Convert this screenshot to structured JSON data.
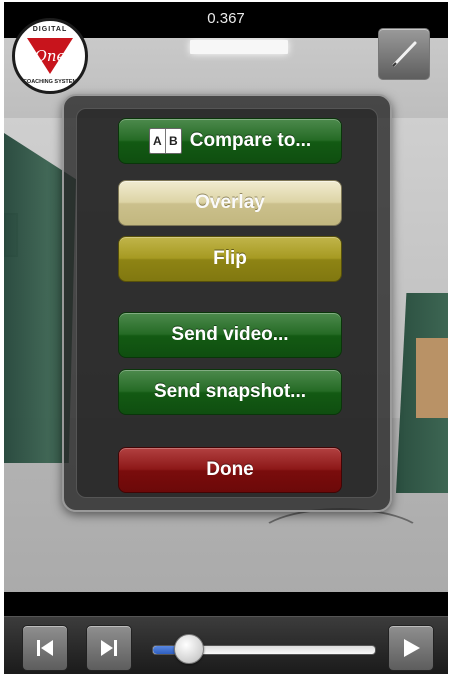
{
  "time_readout": "0.367",
  "logo": {
    "top_text": "DIGITAL",
    "bottom_text": "COACHING SYSTEM",
    "center_text": "One"
  },
  "menu": {
    "compare": {
      "icon_a": "A",
      "icon_b": "B",
      "label": "Compare to..."
    },
    "overlay_label": "Overlay",
    "flip_label": "Flip",
    "send_video_label": "Send video...",
    "send_snapshot_label": "Send snapshot...",
    "done_label": "Done"
  },
  "playback": {
    "position_fraction": 0.16
  },
  "icons": {
    "edit": "pencil-icon",
    "previous": "skip-back-icon",
    "next_frame": "skip-forward-icon",
    "play": "play-icon"
  },
  "colors": {
    "green_button": "#1f5f1f",
    "overlay_button": "#ddd4a6",
    "flip_button": "#a69a22",
    "done_button": "#8d1818",
    "slider_fill": "#3a6ad0"
  }
}
